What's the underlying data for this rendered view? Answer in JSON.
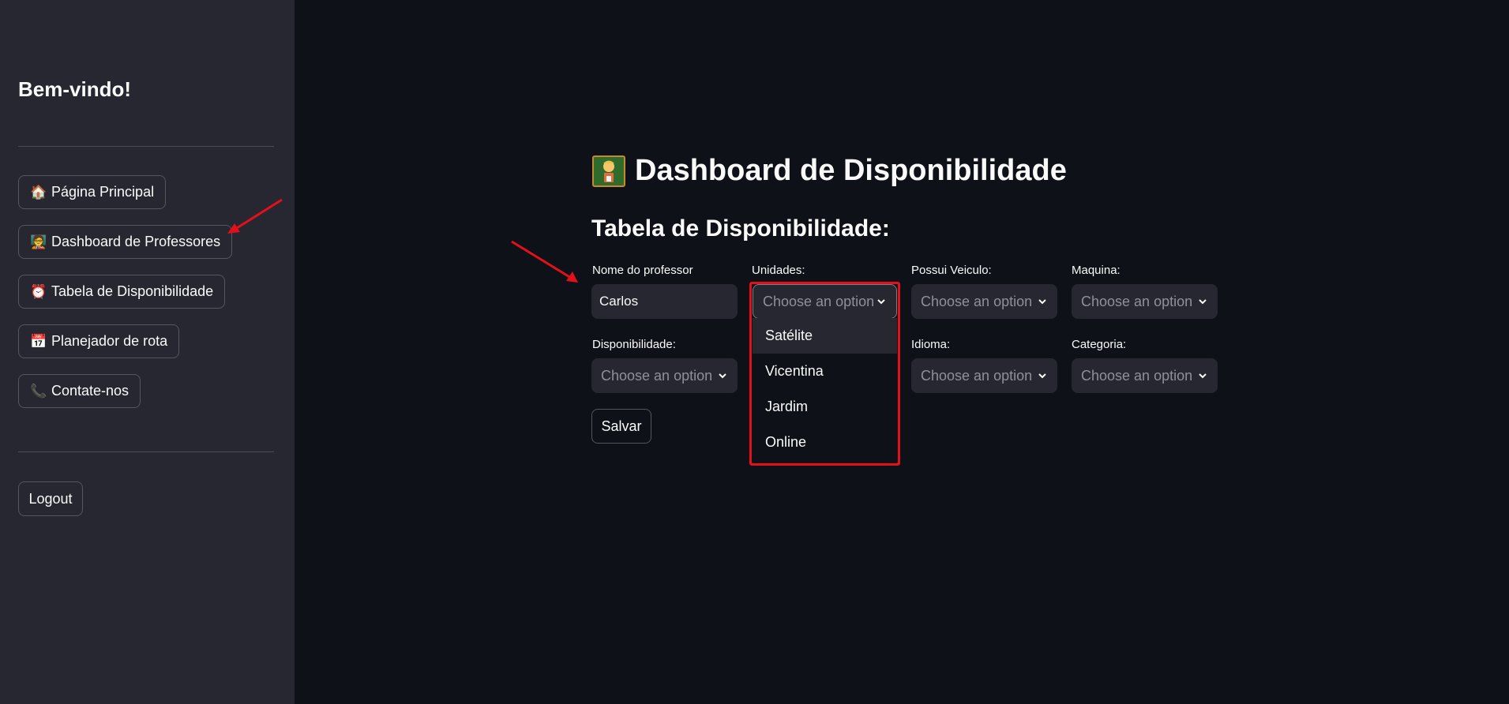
{
  "sidebar": {
    "welcome": "Bem-vindo!",
    "items": [
      {
        "icon": "house-icon",
        "label": "Página Principal"
      },
      {
        "icon": "teacher-icon",
        "label": "Dashboard de Professores"
      },
      {
        "icon": "alarm-clock-icon",
        "label": "Tabela de Disponibilidade"
      },
      {
        "icon": "calendar-icon",
        "label": "Planejador de rota"
      },
      {
        "icon": "phone-icon",
        "label": "Contate-nos"
      }
    ],
    "logout_label": "Logout"
  },
  "main": {
    "title": "Dashboard de Disponibilidade",
    "subtitle": "Tabela de Disponibilidade:",
    "fields": {
      "nome": {
        "label": "Nome do professor",
        "value": "Carlos"
      },
      "unidades": {
        "label": "Unidades:",
        "placeholder": "Choose an option"
      },
      "veiculo": {
        "label": "Possui Veiculo:",
        "placeholder": "Choose an option"
      },
      "maquina": {
        "label": "Maquina:",
        "placeholder": "Choose an option"
      },
      "disponibilidade": {
        "label": "Disponibilidade:",
        "placeholder": "Choose an option"
      },
      "idioma": {
        "label": "Idioma:",
        "placeholder": "Choose an option"
      },
      "categoria": {
        "label": "Categoria:",
        "placeholder": "Choose an option"
      }
    },
    "unidades_options": [
      "Satélite",
      "Vicentina",
      "Jardim",
      "Online"
    ],
    "highlighted_option": "Satélite",
    "save_label": "Salvar"
  },
  "colors": {
    "sidebar_bg": "#262730",
    "main_bg": "#0e1117",
    "annotation_red": "#e3101a"
  }
}
